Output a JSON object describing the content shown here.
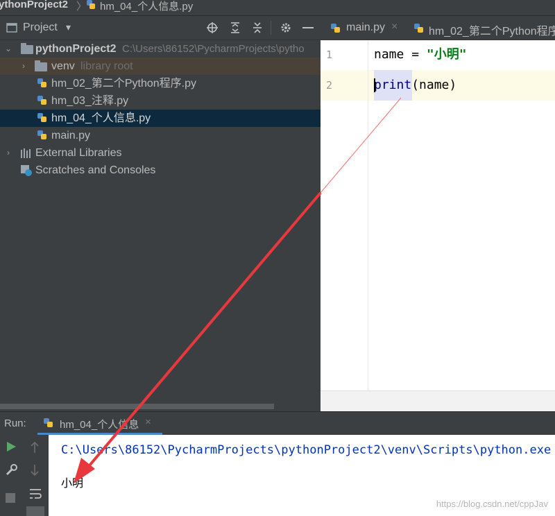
{
  "breadcrumb": {
    "project": "ythonProject2",
    "separator": "〉",
    "file": "hm_04_个人信息.py"
  },
  "project_pane": {
    "title": "Project",
    "dropdown_glyph": "▾",
    "toolbar_icons": [
      "locate-icon",
      "expand-all-icon",
      "collapse-all-icon",
      "settings-icon",
      "hide-icon"
    ],
    "tree": {
      "root_name": "pythonProject2",
      "root_path": "C:\\Users\\86152\\PycharmProjects\\pytho",
      "venv_name": "venv",
      "venv_note": "library root",
      "files": [
        "hm_02_第二个Python程序.py",
        "hm_03_注释.py",
        "hm_04_个人信息.py",
        "main.py"
      ],
      "selected_file": "hm_04_个人信息.py",
      "external_libraries": "External Libraries",
      "scratches": "Scratches and Consoles"
    }
  },
  "editor": {
    "tabs": [
      {
        "label": "main.py",
        "close": "×"
      },
      {
        "label": "hm_02_第二个Python程序"
      }
    ],
    "line_numbers": [
      "1",
      "2"
    ],
    "code": {
      "l1_var": "name",
      "l1_op": " = ",
      "l1_str": "\"小明\"",
      "l2_func": "print",
      "l2_args": "(name)"
    }
  },
  "run_panel": {
    "label": "Run:",
    "tab_label": "hm_04_个人信息",
    "tab_close": "×",
    "console_path": "C:\\Users\\86152\\PycharmProjects\\pythonProject2\\venv\\Scripts\\python.exe",
    "console_output": "小明",
    "watermark": "https://blog.csdn.net/cppJav"
  },
  "colors": {
    "accent_arrow": "#e8383d",
    "string": "#067d17",
    "selection": "#0d293e"
  }
}
